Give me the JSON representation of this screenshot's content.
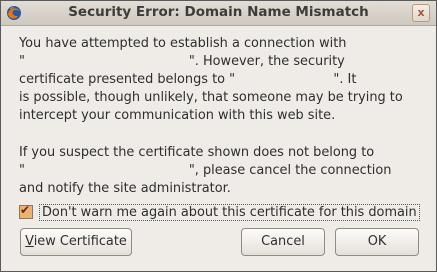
{
  "window": {
    "title": "Security Error: Domain Name Mismatch",
    "close_symbol": "x"
  },
  "message": {
    "paragraph1": "You have attempted to establish a connection with\n\"                                        \". However, the security\ncertificate presented belongs to \"                        \". It\nis possible, though unlikely, that someone may be trying to\nintercept your communication with this web site.",
    "paragraph2": "If you suspect the certificate shown does not belong to\n\"                                        \", please cancel the connection\nand notify the site administrator."
  },
  "checkbox": {
    "label": "Don't warn me again about this certificate for this domain",
    "checked": true
  },
  "buttons": {
    "view_certificate_mnemonic": "V",
    "view_certificate_rest": "iew Certificate",
    "cancel": "Cancel",
    "ok": "OK"
  },
  "icons": {
    "app": "firefox-icon",
    "close": "close-icon"
  }
}
